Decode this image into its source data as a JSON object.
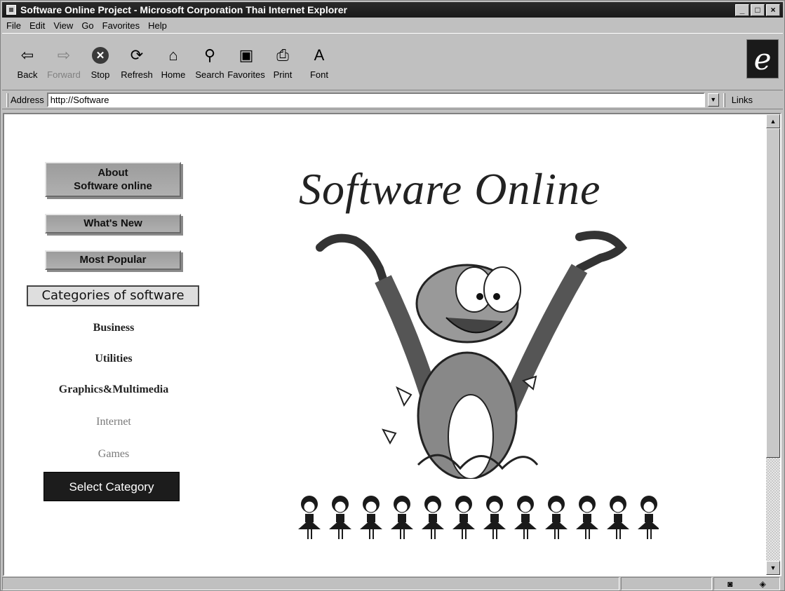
{
  "window": {
    "title": "Software Online Project - Microsoft Corporation Thai Internet Explorer",
    "controls": [
      "_",
      "□",
      "×"
    ]
  },
  "menu": [
    "File",
    "Edit",
    "View",
    "Go",
    "Favorites",
    "Help"
  ],
  "toolbar": {
    "buttons": [
      {
        "label": "Back",
        "icon": "back-arrow-icon",
        "glyph": "⇦",
        "enabled": true
      },
      {
        "label": "Forward",
        "icon": "forward-arrow-icon",
        "glyph": "⇨",
        "enabled": false
      },
      {
        "label": "Stop",
        "icon": "stop-icon",
        "glyph": "✕",
        "enabled": true
      },
      {
        "label": "Refresh",
        "icon": "refresh-icon",
        "glyph": "⟳",
        "enabled": true
      },
      {
        "label": "Home",
        "icon": "home-icon",
        "glyph": "⌂",
        "enabled": true
      },
      {
        "label": "Search",
        "icon": "search-icon",
        "glyph": "⚲",
        "enabled": true
      },
      {
        "label": "Favorites",
        "icon": "favorites-icon",
        "glyph": "▣",
        "enabled": true
      },
      {
        "label": "Print",
        "icon": "print-icon",
        "glyph": "⎙",
        "enabled": true
      },
      {
        "label": "Font",
        "icon": "font-icon",
        "glyph": "A",
        "enabled": true
      }
    ],
    "brand_glyph": "e"
  },
  "address": {
    "label": "Address",
    "value": "http://Software",
    "links_label": "Links"
  },
  "page": {
    "heading": "Software Online",
    "nav": {
      "about_line1": "About",
      "about_line2": "Software online",
      "whats_new": "What's New",
      "most_popular": "Most Popular"
    },
    "categories_title": "Categories of software",
    "categories": [
      "Business",
      "Utilities",
      "Graphics&Multimedia",
      "Internet",
      "Games"
    ],
    "select_button": "Select Category",
    "doll_count": 12
  }
}
